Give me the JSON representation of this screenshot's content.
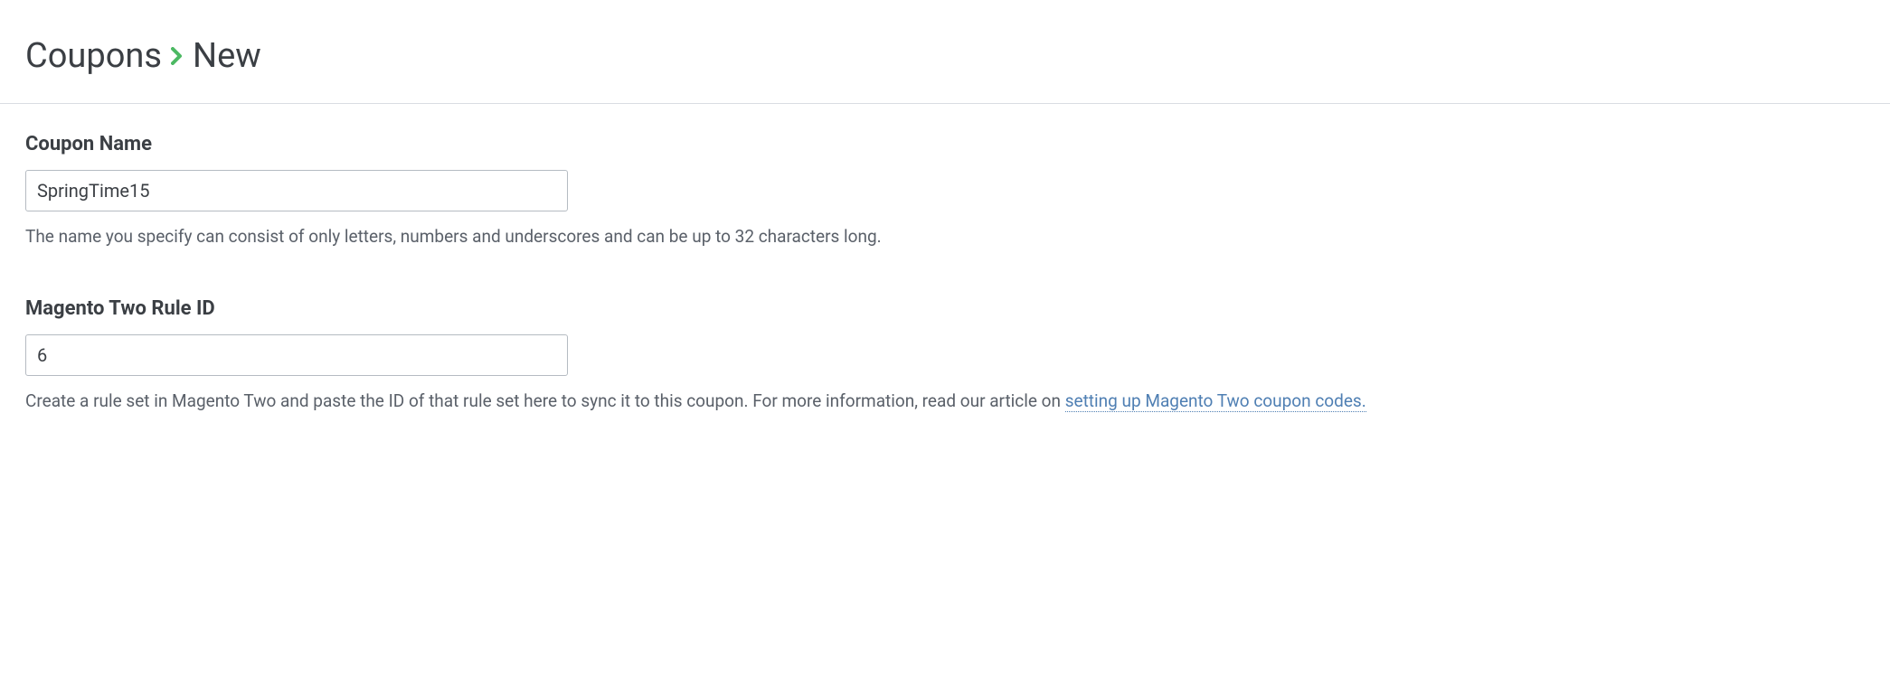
{
  "breadcrumb": {
    "root": "Coupons",
    "current": "New"
  },
  "form": {
    "couponName": {
      "label": "Coupon Name",
      "value": "SpringTime15",
      "help": "The name you specify can consist of only letters, numbers and underscores and can be up to 32 characters long."
    },
    "ruleId": {
      "label": "Magento Two Rule ID",
      "value": "6",
      "helpPrefix": "Create a rule set in Magento Two and paste the ID of that rule set here to sync it to this coupon. For more information, read our article on ",
      "helpLink": "setting up Magento Two coupon codes."
    }
  }
}
